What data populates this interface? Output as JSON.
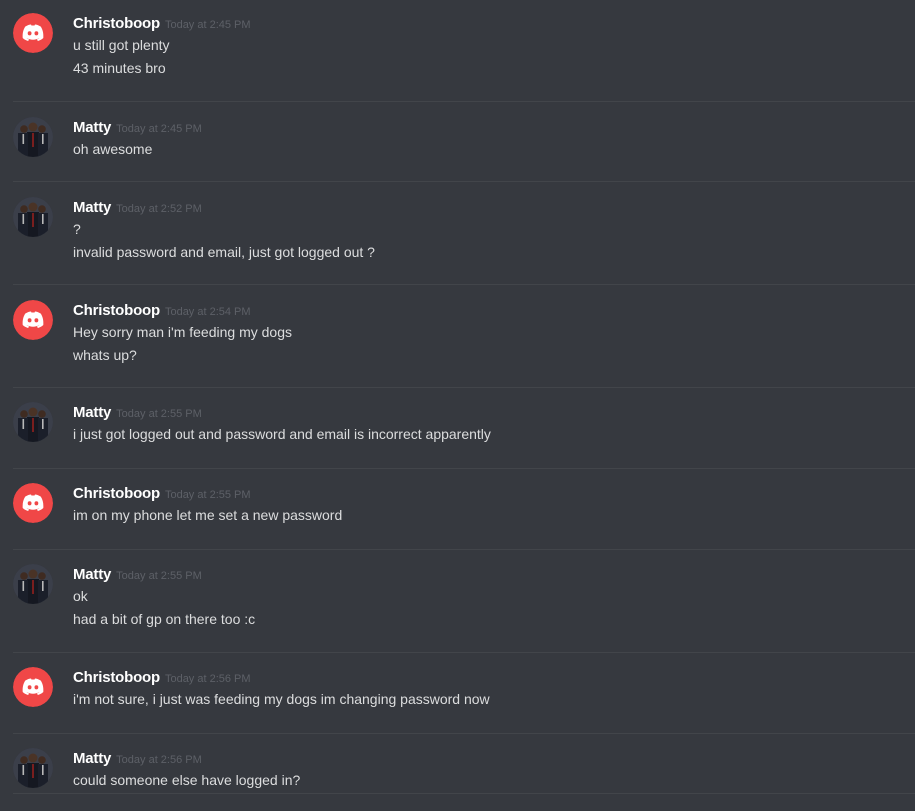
{
  "messages": [
    {
      "author": "Christoboop",
      "avatar": "discord-logo-icon",
      "time": "Today at 2:45 PM",
      "lines": [
        "u still got plenty",
        "43 minutes bro"
      ]
    },
    {
      "author": "Matty",
      "avatar": "user-photo-icon",
      "time": "Today at 2:45 PM",
      "lines": [
        "oh awesome"
      ]
    },
    {
      "author": "Matty",
      "avatar": "user-photo-icon",
      "time": "Today at 2:52 PM",
      "lines": [
        "?",
        "invalid password and email, just got logged out ?"
      ]
    },
    {
      "author": "Christoboop",
      "avatar": "discord-logo-icon",
      "time": "Today at 2:54 PM",
      "lines": [
        "Hey sorry man i'm feeding my dogs",
        "whats up?"
      ]
    },
    {
      "author": "Matty",
      "avatar": "user-photo-icon",
      "time": "Today at 2:55 PM",
      "lines": [
        "i just got logged out and password and email is incorrect apparently"
      ]
    },
    {
      "author": "Christoboop",
      "avatar": "discord-logo-icon",
      "time": "Today at 2:55 PM",
      "lines": [
        "im on my phone let me set a new password"
      ]
    },
    {
      "author": "Matty",
      "avatar": "user-photo-icon",
      "time": "Today at 2:55 PM",
      "lines": [
        "ok",
        "had a bit of gp on there too :c"
      ]
    },
    {
      "author": "Christoboop",
      "avatar": "discord-logo-icon",
      "time": "Today at 2:56 PM",
      "lines": [
        "i'm not sure, i just was feeding my dogs im changing password now"
      ]
    },
    {
      "author": "Matty",
      "avatar": "user-photo-icon",
      "time": "Today at 2:56 PM",
      "lines": [
        "could someone else have logged in?"
      ]
    }
  ],
  "colors": {
    "background": "#36393f",
    "username": "#ffffff",
    "timestamp": "#5d6067",
    "message_text": "#dcddde",
    "divider": "#42454a",
    "discord_avatar": "#f04747"
  }
}
